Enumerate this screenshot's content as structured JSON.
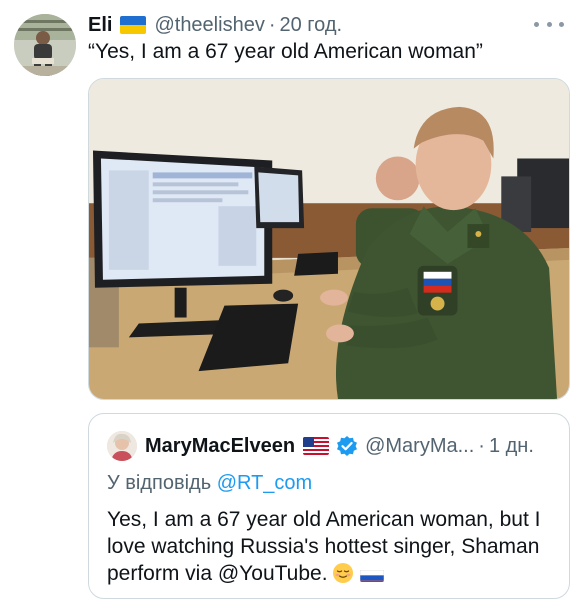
{
  "tweet": {
    "author": {
      "display_name": "Eli",
      "handle": "@theelishev",
      "flag": "ukraine-flag",
      "avatar": "user-avatar"
    },
    "separator": "·",
    "time": "20 год.",
    "text": "“Yes, I am a 67 year old American woman”",
    "media": {
      "description_icon": "photo",
      "colors": {
        "wall": "#e9e3d6",
        "desk": "#c9ab79",
        "uniform": "#3e5431"
      }
    }
  },
  "quote": {
    "author": {
      "display_name": "MaryMacElveen",
      "handle": "@MaryMa...",
      "flag": "us-flag",
      "verified": true
    },
    "separator": "·",
    "time": "1 дн.",
    "reply_prefix": "У відповідь",
    "reply_handle": "@RT_com",
    "body": "Yes, I am a 67 year old American woman, but I love watching Russia's hottest singer, Shaman perform via @YouTube.",
    "trailing_emojis": [
      "relieved-face-emoji",
      "russia-flag"
    ]
  },
  "colors": {
    "text": "#0f1419",
    "secondary": "#536471",
    "link": "#1d9bf0",
    "border": "#cfd9de",
    "verified": "#1d9bf0"
  }
}
